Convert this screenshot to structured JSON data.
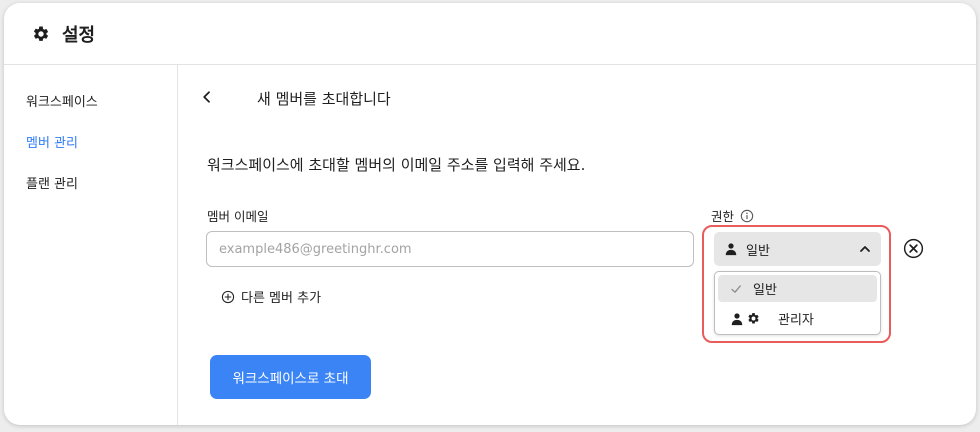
{
  "header": {
    "title": "설정",
    "icon": "gear-icon"
  },
  "sidebar": {
    "items": [
      {
        "label": "워크스페이스",
        "active": false
      },
      {
        "label": "멤버 관리",
        "active": true
      },
      {
        "label": "플랜 관리",
        "active": false
      }
    ]
  },
  "main": {
    "page_title": "새 멤버를 초대합니다",
    "instruction": "워크스페이스에 초대할 멤버의 이메일 주소를 입력해 주세요.",
    "email_label": "멤버 이메일",
    "email_placeholder": "example486@greetinghr.com",
    "email_value": "",
    "permission_label": "권한",
    "permission_selected": "일반",
    "permission_options": [
      {
        "label": "일반",
        "selected": true
      },
      {
        "label": "관리자",
        "selected": false
      }
    ],
    "add_member_label": "다른 멤버 추가",
    "invite_button_label": "워크스페이스로 초대"
  },
  "colors": {
    "accent": "#3b84f6",
    "active_nav": "#2f7cf6",
    "highlight": "#ea5b5b"
  }
}
